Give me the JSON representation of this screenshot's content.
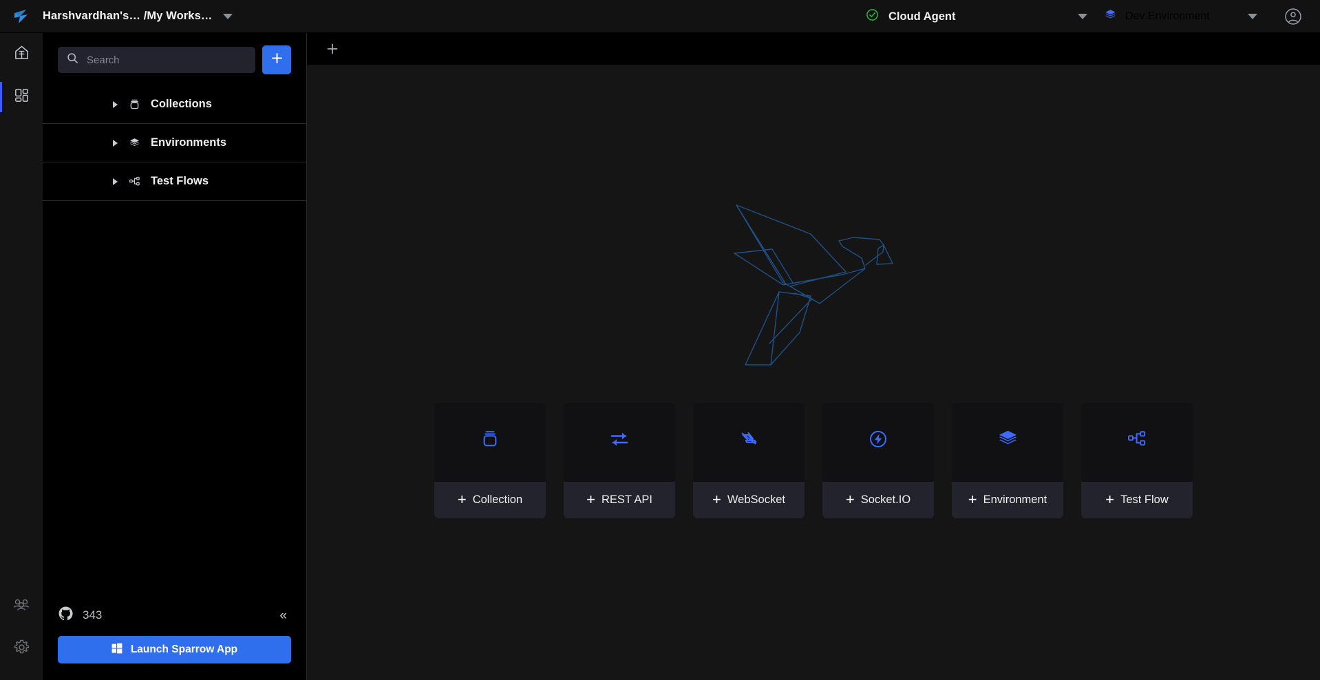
{
  "header": {
    "logo_icon": "sparrow-bird-logo",
    "workspace_title": "Harshvardhan's… /My Works…",
    "workspace_caret_icon": "chevron-down-icon",
    "agent": {
      "status_icon": "check-circle-icon",
      "label": "Cloud Agent",
      "caret_icon": "chevron-down-icon",
      "status_color": "#2fb344"
    },
    "environment": {
      "icon": "layers-icon",
      "label": "Dev Environment",
      "caret_icon": "chevron-down-icon",
      "icon_color": "#3d6aff"
    },
    "account_icon": "user-circle-icon"
  },
  "rail": {
    "items": [
      {
        "name": "home",
        "icon": "home-icon",
        "active": false
      },
      {
        "name": "workspace",
        "icon": "grid-dashboard-icon",
        "active": true
      }
    ],
    "bottom_items": [
      {
        "name": "team",
        "icon": "users-icon"
      },
      {
        "name": "settings",
        "icon": "gear-icon"
      }
    ],
    "active_indicator_color": "#3d5afe"
  },
  "sidebar": {
    "search": {
      "placeholder": "Search",
      "value": "",
      "icon": "search-icon"
    },
    "add_button": {
      "icon": "plus-icon",
      "color": "#2f6fed"
    },
    "tree": [
      {
        "label": "Collections",
        "icon": "collection-jar-icon",
        "expand_icon": "triangle-right-icon"
      },
      {
        "label": "Environments",
        "icon": "layers-icon",
        "expand_icon": "triangle-right-icon"
      },
      {
        "label": "Test Flows",
        "icon": "flow-nodes-icon",
        "expand_icon": "triangle-right-icon"
      }
    ],
    "footer": {
      "github_icon": "github-icon",
      "star_count": "343",
      "collapse_icon": "chevron-double-left-icon",
      "collapse_glyph": "«",
      "launch_button": {
        "label": "Launch Sparrow App",
        "icon": "windows-icon",
        "color": "#2f6fed"
      }
    }
  },
  "main": {
    "tabbar": {
      "add_tab_icon": "plus-icon"
    },
    "illustration": {
      "name": "sparrow-bird-outline",
      "color": "#1f4f8f"
    },
    "cards": [
      {
        "label": "Collection",
        "icon": "collection-jar-icon",
        "plus": "+"
      },
      {
        "label": "REST API",
        "icon": "rest-api-arrows-icon",
        "plus": "+"
      },
      {
        "label": "WebSocket",
        "icon": "websocket-icon",
        "plus": "+"
      },
      {
        "label": "Socket.IO",
        "icon": "socketio-bolt-icon",
        "plus": "+"
      },
      {
        "label": "Environment",
        "icon": "layers-icon",
        "plus": "+"
      },
      {
        "label": "Test Flow",
        "icon": "flow-nodes-icon",
        "plus": "+"
      }
    ],
    "card_icon_color": "#3d6aff"
  }
}
